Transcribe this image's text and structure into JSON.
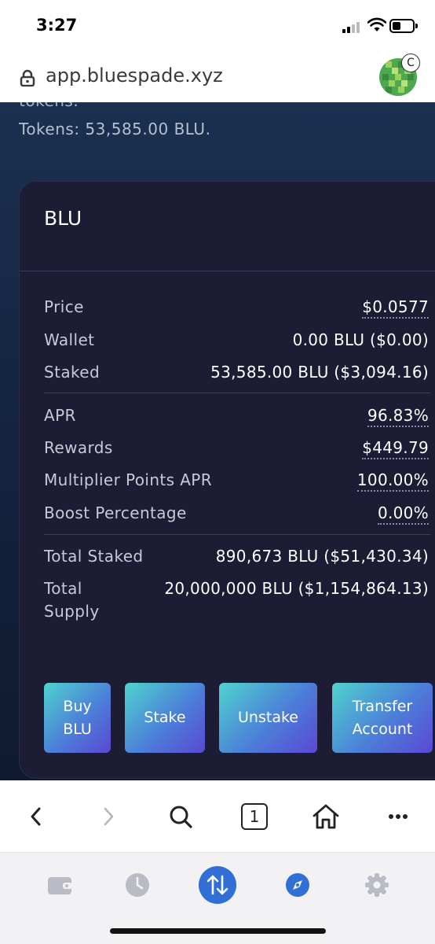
{
  "status_bar": {
    "time": "3:27"
  },
  "address_bar": {
    "url": "app.bluespade.xyz",
    "avatar_badge": "C"
  },
  "intro": {
    "partial_text": "tokens.",
    "tokens_text": "Tokens: 53,585.00 BLU."
  },
  "card": {
    "title": "BLU",
    "rows": [
      {
        "label": "Price",
        "value": "$0.0577"
      },
      {
        "label": "Wallet",
        "value": "0.00 BLU ($0.00)"
      },
      {
        "label": "Staked",
        "value": "53,585.00 BLU ($3,094.16)"
      },
      {
        "label": "APR",
        "value": "96.83%"
      },
      {
        "label": "Rewards",
        "value": "$449.79"
      },
      {
        "label": "Multiplier Points APR",
        "value": "100.00%"
      },
      {
        "label": "Boost Percentage",
        "value": "0.00%"
      },
      {
        "label": "Total Staked",
        "value": "890,673 BLU ($51,430.34)"
      },
      {
        "label": "Total",
        "label_line2": "Supply",
        "value": "20,000,000 BLU ($1,154,864.13)"
      }
    ],
    "buttons": {
      "buy_line1": "Buy",
      "buy_line2": "BLU",
      "stake": "Stake",
      "unstake": "Unstake",
      "transfer_line1": "Transfer",
      "transfer_line2": "Account"
    }
  },
  "toolbar": {
    "tab_count": "1"
  },
  "colors": {
    "page_bg": "#152642",
    "card_bg": "#1c1c35",
    "button_gradient_start": "#4fd3cf",
    "button_gradient_end": "#5a48d4",
    "wallet_active": "#2f6fd6"
  },
  "icons": {
    "lock": "lock-icon",
    "back": "chevron-left-icon",
    "forward": "chevron-right-icon",
    "search": "search-icon",
    "tabs": "tabs-icon",
    "home": "home-icon",
    "more": "more-icon",
    "wallet": "wallet-icon",
    "history": "clock-icon",
    "swap": "swap-icon",
    "explore": "compass-icon",
    "settings": "gear-icon"
  }
}
